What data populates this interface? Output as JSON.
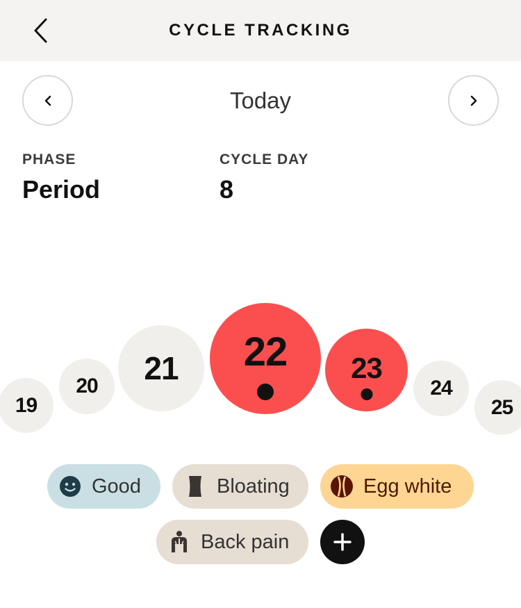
{
  "header": {
    "title": "CYCLE TRACKING",
    "back_icon": "chevron-left-icon"
  },
  "date_nav": {
    "current": "Today",
    "prev_icon": "chevron-left-icon",
    "next_icon": "chevron-right-icon"
  },
  "stats": {
    "phase": {
      "label": "PHASE",
      "value": "Period"
    },
    "cycle_day": {
      "label": "CYCLE DAY",
      "value": "8"
    }
  },
  "days": [
    {
      "number": "19",
      "status": "neutral"
    },
    {
      "number": "20",
      "status": "neutral"
    },
    {
      "number": "21",
      "status": "neutral"
    },
    {
      "number": "22",
      "status": "period",
      "logged": true,
      "selected": true
    },
    {
      "number": "23",
      "status": "period",
      "logged": true
    },
    {
      "number": "24",
      "status": "neutral"
    },
    {
      "number": "25",
      "status": "neutral"
    }
  ],
  "tags": [
    {
      "label": "Good",
      "category": "mood",
      "icon": "smiley-icon"
    },
    {
      "label": "Bloating",
      "category": "symptom",
      "icon": "bloating-icon"
    },
    {
      "label": "Egg white",
      "category": "discharge",
      "icon": "egg-white-icon"
    },
    {
      "label": "Back pain",
      "category": "symptom",
      "icon": "back-pain-icon"
    }
  ],
  "add_button": {
    "icon": "plus-icon"
  },
  "colors": {
    "header_bg": "#f4f3f1",
    "period": "#fb4f4f",
    "neutral_day": "#f1efeb",
    "mood_chip": "#c9dfe3",
    "symptom_chip": "#e6ddd3",
    "discharge_chip": "#fed593"
  }
}
